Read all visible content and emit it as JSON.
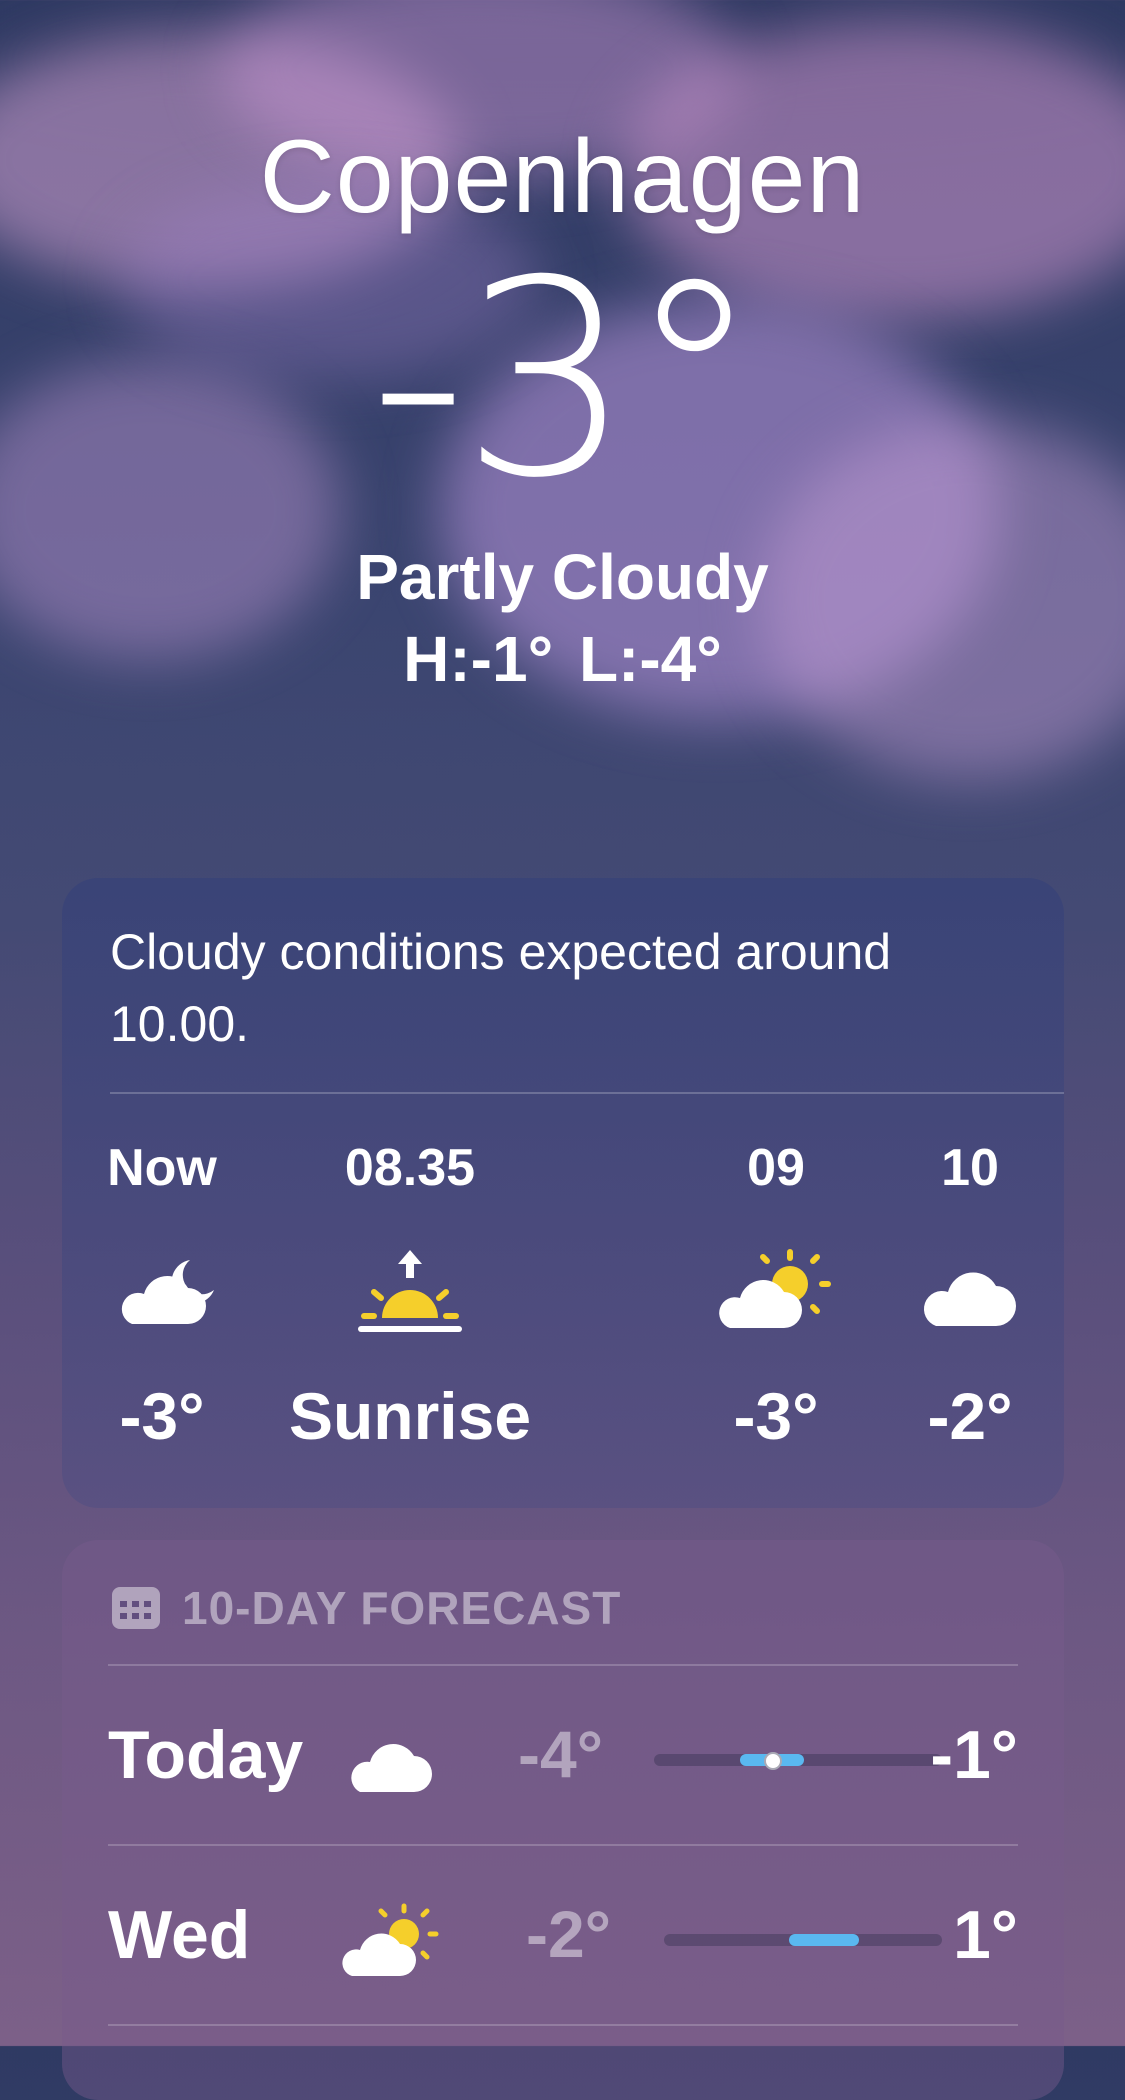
{
  "location": {
    "city": "Copenhagen",
    "temperature": "-3°",
    "condition": "Partly Cloudy",
    "high_low": "H:-1°  L:-4°"
  },
  "hourly": {
    "summary": "Cloudy conditions expected around 10.00.",
    "items": [
      {
        "time": "Now",
        "icon": "cloud-moon-icon",
        "value": "-3°"
      },
      {
        "time": "08.35",
        "icon": "sunrise-icon",
        "value": "Sunrise"
      },
      {
        "time": "09",
        "icon": "cloud-sun-icon",
        "value": "-3°"
      },
      {
        "time": "10",
        "icon": "cloud-icon",
        "value": "-2°"
      }
    ]
  },
  "forecast": {
    "title": "10-DAY FORECAST",
    "icon": "calendar-icon",
    "days": [
      {
        "day": "Today",
        "icon": "cloud-icon",
        "low": "-4°",
        "high": "-1°",
        "bar_start": 0.3,
        "bar_end": 0.52,
        "current": 0.41
      },
      {
        "day": "Wed",
        "icon": "cloud-sun-icon",
        "low": "-2°",
        "high": "1°",
        "bar_start": 0.45,
        "bar_end": 0.7
      }
    ]
  },
  "colors": {
    "sun": "#f5cf2b",
    "bar_fill": "#5ab8f0"
  }
}
